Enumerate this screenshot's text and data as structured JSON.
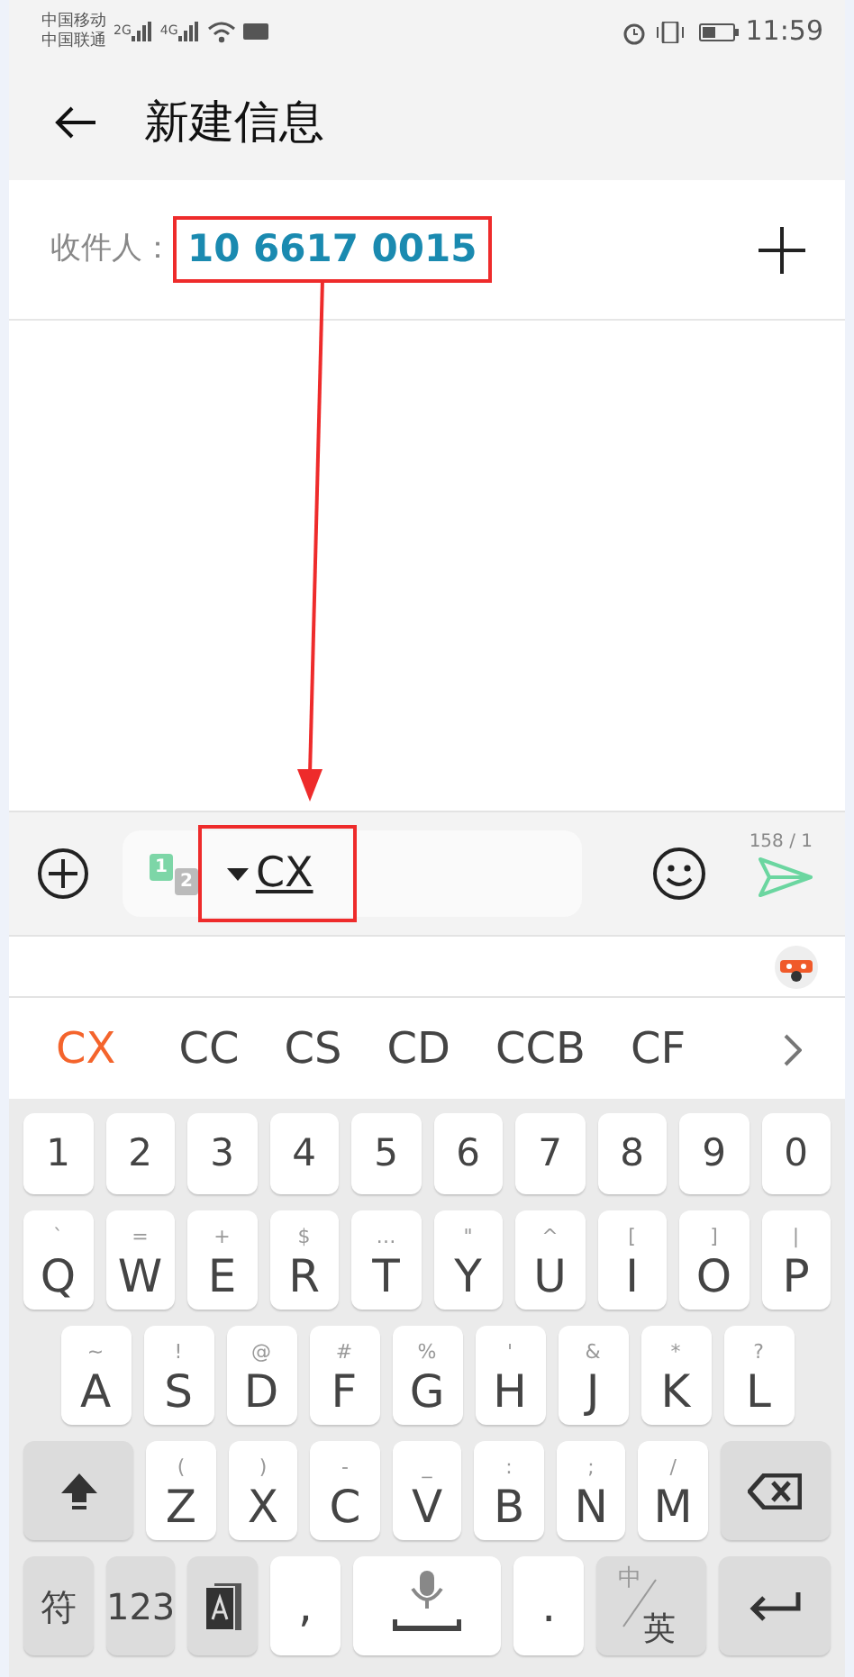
{
  "status_bar": {
    "carriers": [
      "中国移动",
      "中国联通"
    ],
    "networks": [
      "2G",
      "4G"
    ],
    "time": "11:59"
  },
  "header": {
    "title": "新建信息"
  },
  "recipient": {
    "label": "收件人：",
    "value": "10 6617 0015",
    "highlighted": true
  },
  "annotation_arrow": true,
  "compose": {
    "sims": [
      "1",
      "2"
    ],
    "text": "CX",
    "highlighted": true,
    "counter": "158 / 1"
  },
  "candidates": [
    {
      "text": "CX",
      "selected": true
    },
    {
      "text": "CC",
      "selected": false
    },
    {
      "text": "CS",
      "selected": false
    },
    {
      "text": "CD",
      "selected": false
    },
    {
      "text": "CCB",
      "selected": false
    },
    {
      "text": "CF",
      "selected": false
    }
  ],
  "keyboard": [
    [
      {
        "kind": "char",
        "label": "1"
      },
      {
        "kind": "char",
        "label": "2"
      },
      {
        "kind": "char",
        "label": "3"
      },
      {
        "kind": "char",
        "label": "4"
      },
      {
        "kind": "char",
        "label": "5"
      },
      {
        "kind": "char",
        "label": "6"
      },
      {
        "kind": "char",
        "label": "7"
      },
      {
        "kind": "char",
        "label": "8"
      },
      {
        "kind": "char",
        "label": "9"
      },
      {
        "kind": "char",
        "label": "0"
      }
    ],
    [
      {
        "kind": "char",
        "label": "Q",
        "hint": "`"
      },
      {
        "kind": "char",
        "label": "W",
        "hint": "="
      },
      {
        "kind": "char",
        "label": "E",
        "hint": "+"
      },
      {
        "kind": "char",
        "label": "R",
        "hint": "$"
      },
      {
        "kind": "char",
        "label": "T",
        "hint": "…"
      },
      {
        "kind": "char",
        "label": "Y",
        "hint": "\""
      },
      {
        "kind": "char",
        "label": "U",
        "hint": "^"
      },
      {
        "kind": "char",
        "label": "I",
        "hint": "["
      },
      {
        "kind": "char",
        "label": "O",
        "hint": "]"
      },
      {
        "kind": "char",
        "label": "P",
        "hint": "|"
      }
    ],
    [
      {
        "kind": "char",
        "label": "A",
        "hint": "~"
      },
      {
        "kind": "char",
        "label": "S",
        "hint": "!"
      },
      {
        "kind": "char",
        "label": "D",
        "hint": "@"
      },
      {
        "kind": "char",
        "label": "F",
        "hint": "#"
      },
      {
        "kind": "char",
        "label": "G",
        "hint": "%"
      },
      {
        "kind": "char",
        "label": "H",
        "hint": "'"
      },
      {
        "kind": "char",
        "label": "J",
        "hint": "&"
      },
      {
        "kind": "char",
        "label": "K",
        "hint": "*"
      },
      {
        "kind": "char",
        "label": "L",
        "hint": "?"
      }
    ],
    [
      {
        "kind": "shift"
      },
      {
        "kind": "char",
        "label": "Z",
        "hint": "("
      },
      {
        "kind": "char",
        "label": "X",
        "hint": ")"
      },
      {
        "kind": "char",
        "label": "C",
        "hint": "-"
      },
      {
        "kind": "char",
        "label": "V",
        "hint": "_"
      },
      {
        "kind": "char",
        "label": "B",
        "hint": ":"
      },
      {
        "kind": "char",
        "label": "N",
        "hint": ";"
      },
      {
        "kind": "char",
        "label": "M",
        "hint": "/"
      },
      {
        "kind": "backspace"
      }
    ],
    [
      {
        "kind": "func",
        "label": "符"
      },
      {
        "kind": "func",
        "label": "123"
      },
      {
        "kind": "book"
      },
      {
        "kind": "punct",
        "label": ","
      },
      {
        "kind": "space"
      },
      {
        "kind": "punct",
        "label": "."
      },
      {
        "kind": "lang",
        "top": "中",
        "bottom": "英"
      },
      {
        "kind": "enter"
      }
    ]
  ]
}
